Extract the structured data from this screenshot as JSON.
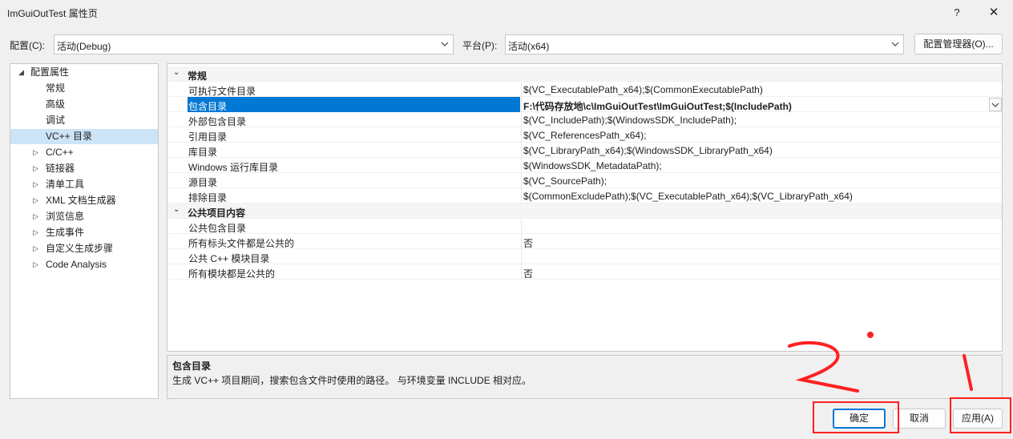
{
  "window": {
    "title": "ImGuiOutTest 属性页",
    "help_label": "?",
    "close_label": "✕"
  },
  "config_bar": {
    "config_label": "配置(C):",
    "config_value": "活动(Debug)",
    "platform_label": "平台(P):",
    "platform_value": "活动(x64)",
    "manager_label": "配置管理器(O)..."
  },
  "tree": {
    "items": [
      {
        "label": "配置属性",
        "toggle": "◢",
        "level": 0
      },
      {
        "label": "常规",
        "toggle": "",
        "level": 1
      },
      {
        "label": "高级",
        "toggle": "",
        "level": 1
      },
      {
        "label": "调试",
        "toggle": "",
        "level": 1
      },
      {
        "label": "VC++ 目录",
        "toggle": "",
        "level": 1,
        "selected": true
      },
      {
        "label": "C/C++",
        "toggle": "▷",
        "level": 1
      },
      {
        "label": "链接器",
        "toggle": "▷",
        "level": 1
      },
      {
        "label": "清单工具",
        "toggle": "▷",
        "level": 1
      },
      {
        "label": "XML 文档生成器",
        "toggle": "▷",
        "level": 1
      },
      {
        "label": "浏览信息",
        "toggle": "▷",
        "level": 1
      },
      {
        "label": "生成事件",
        "toggle": "▷",
        "level": 1
      },
      {
        "label": "自定义生成步骤",
        "toggle": "▷",
        "level": 1
      },
      {
        "label": "Code Analysis",
        "toggle": "▷",
        "level": 1
      }
    ]
  },
  "grid": {
    "rows": [
      {
        "type": "cat",
        "name": "常规",
        "toggle": "⌄"
      },
      {
        "type": "prop",
        "name": "可执行文件目录",
        "value": "$(VC_ExecutablePath_x64);$(CommonExecutablePath)"
      },
      {
        "type": "prop",
        "name": "包含目录",
        "value": "F:\\代码存放地\\c\\ImGuiOutTest\\ImGuiOutTest;$(IncludePath)",
        "selected": true
      },
      {
        "type": "prop",
        "name": "外部包含目录",
        "value": "$(VC_IncludePath);$(WindowsSDK_IncludePath);"
      },
      {
        "type": "prop",
        "name": "引用目录",
        "value": "$(VC_ReferencesPath_x64);"
      },
      {
        "type": "prop",
        "name": "库目录",
        "value": "$(VC_LibraryPath_x64);$(WindowsSDK_LibraryPath_x64)"
      },
      {
        "type": "prop",
        "name": "Windows 运行库目录",
        "value": "$(WindowsSDK_MetadataPath);"
      },
      {
        "type": "prop",
        "name": "源目录",
        "value": "$(VC_SourcePath);"
      },
      {
        "type": "prop",
        "name": "排除目录",
        "value": "$(CommonExcludePath);$(VC_ExecutablePath_x64);$(VC_LibraryPath_x64)"
      },
      {
        "type": "cat",
        "name": "公共项目内容",
        "toggle": "⌄"
      },
      {
        "type": "prop",
        "name": "公共包含目录",
        "value": ""
      },
      {
        "type": "prop",
        "name": "所有标头文件都是公共的",
        "value": "否"
      },
      {
        "type": "prop",
        "name": "公共 C++ 模块目录",
        "value": ""
      },
      {
        "type": "prop",
        "name": "所有模块都是公共的",
        "value": "否"
      }
    ]
  },
  "description": {
    "title": "包含目录",
    "text": "生成 VC++ 项目期间，搜索包含文件时使用的路径。 与环境变量 INCLUDE 相对应。"
  },
  "buttons": {
    "ok": "确定",
    "cancel": "取消",
    "apply": "应用(A)"
  },
  "colors": {
    "accent": "#0078d4",
    "tree_selected": "#cce4f7",
    "annotation": "#ff2020"
  }
}
